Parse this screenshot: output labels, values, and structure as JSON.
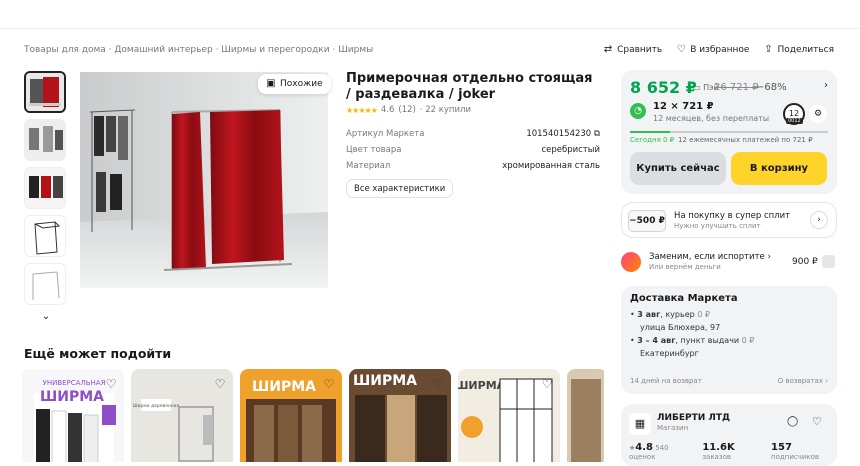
{
  "breadcrumb": [
    "Товары для дома",
    "Домашний интерьер",
    "Ширмы и перегородки",
    "Ширмы"
  ],
  "header_actions": {
    "compare": "Сравнить",
    "favorite": "В избранное",
    "share": "Поделиться"
  },
  "gallery": {
    "similar_label": "Похожие"
  },
  "product": {
    "title": "Примерочная отдельно стоящая / раздевалка / joker",
    "rating": "4.6",
    "reviews": "(12)",
    "bought": "· 22 купили",
    "specs": [
      {
        "key": "Артикул Маркета",
        "value": "101540154230"
      },
      {
        "key": "Цвет товара",
        "value": "серебристый"
      },
      {
        "key": "Материал",
        "value": "хромированная сталь"
      }
    ],
    "all_specs_label": "Все характеристики"
  },
  "recommend": {
    "title": "Ещё может подойти",
    "cards": [
      {
        "label": "УНИВЕРСАЛЬНАЯ ШИРМА",
        "bg": "#8e4ec7"
      },
      {
        "label": "Ширма деревянная с текстилем",
        "bg": "#e8e6e0"
      },
      {
        "label": "ШИРМА",
        "bg": "#f0a12b"
      },
      {
        "label": "ШИРМА",
        "bg": "#5a3a24"
      },
      {
        "label": "ШИРМА универсальная",
        "bg": "#f2ede3"
      },
      {
        "label": "",
        "bg": "#d9c9b0"
      }
    ]
  },
  "buy": {
    "price": "8 652 ₽",
    "pay_label": "Пэй",
    "old_price": "26 721 ₽",
    "discount": "−68%",
    "split_main": "12 × 721 ₽",
    "split_sub": "12 месяцев, без переплаты",
    "split_months": "12",
    "split_period": "0012",
    "today": "Сегодня 0 ₽",
    "payments": "12 ежемесячных платежей по 721 ₽",
    "split_progress": 0.2,
    "buy_now": "Купить сейчас",
    "to_cart": "В корзину"
  },
  "promo": {
    "tag": "−500 ₽",
    "title": "На покупку в супер сплит",
    "sub": "Нужно улучшить сплит"
  },
  "insurance": {
    "title": "Заменим, если испортите",
    "sub": "Или вернём деньги",
    "price": "900 ₽"
  },
  "delivery": {
    "title": "Доставка Маркета",
    "courier_date": "3 авг",
    "courier_text": ", курьер",
    "courier_price": "0 ₽",
    "courier_addr": "улица Блюхера, 97",
    "pickup_date": "3 – 4 авг",
    "pickup_text": ", пункт выдачи",
    "pickup_price": "0 ₽",
    "pickup_city": "Екатеринбург",
    "return": "14 дней на возврат",
    "about_return": "О возвратах"
  },
  "seller": {
    "name": "ЛИБЕРТИ ЛТД",
    "type": "Магазин",
    "rating": "4.8",
    "rating_label": "540 оценок",
    "orders": "11.6K",
    "orders_label": "заказов",
    "subs": "157",
    "subs_label": "подписчиков"
  },
  "colors": {
    "accent_green": "#00a64f",
    "cart_yellow": "#fed42b",
    "curtain_red": "#b3121a"
  }
}
